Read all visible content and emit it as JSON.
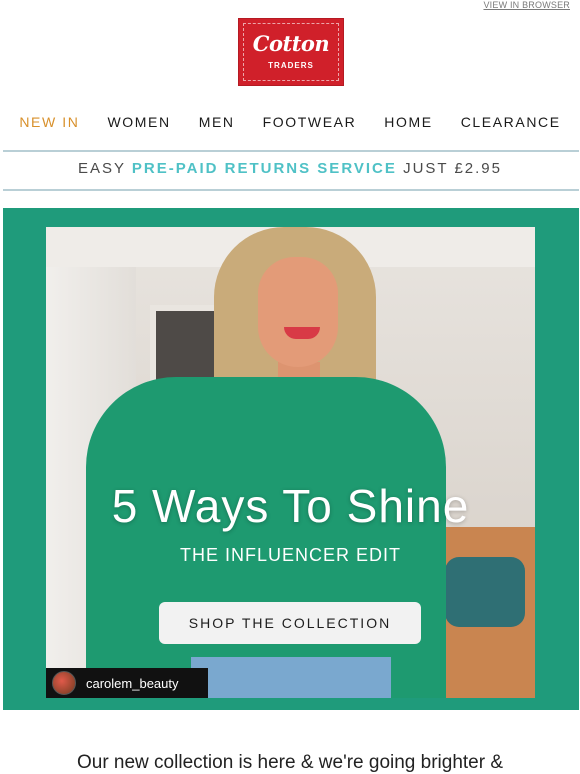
{
  "header": {
    "view_in_browser": "VIEW IN BROWSER",
    "logo": {
      "script": "Cotton",
      "sub": "TRADERS",
      "brand_color": "#d0202a"
    }
  },
  "nav": {
    "items": [
      {
        "label": "NEW IN",
        "accent": true
      },
      {
        "label": "WOMEN"
      },
      {
        "label": "MEN"
      },
      {
        "label": "FOOTWEAR"
      },
      {
        "label": "HOME"
      },
      {
        "label": "CLEARANCE"
      }
    ],
    "accent_color": "#d8902b"
  },
  "returns_bar": {
    "prefix": "EASY",
    "highlight": "PRE-PAID RETURNS SERVICE",
    "suffix": "JUST £2.95",
    "highlight_color": "#4fc1c6"
  },
  "hero": {
    "background_color": "#1f9b7b",
    "headline": "5 Ways To Shine",
    "subhead": "THE INFLUENCER EDIT",
    "cta_label": "SHOP THE COLLECTION",
    "influencer_handle": "carolem_beauty"
  },
  "body": {
    "intro": "Our new collection is here & we're going brighter &"
  }
}
